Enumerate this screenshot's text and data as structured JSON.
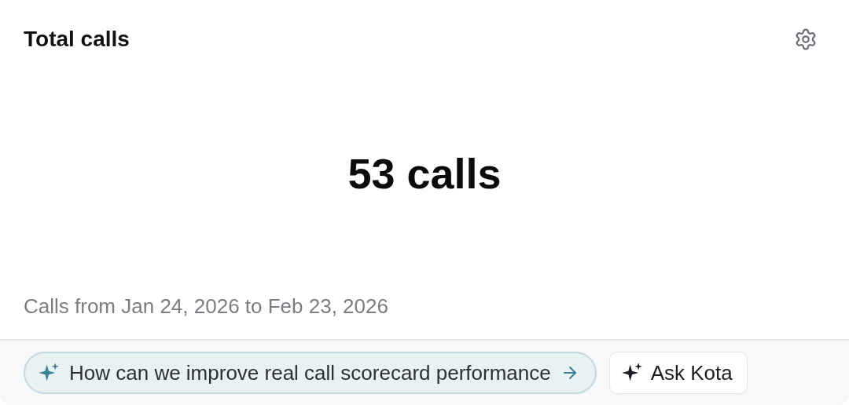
{
  "card": {
    "title": "Total calls",
    "value": "53 calls",
    "caption": "Calls from Jan 24, 2026 to Feb 23, 2026"
  },
  "footer": {
    "suggestion": "How can we improve real call scorecard performance",
    "ask_button": "Ask Kota"
  }
}
